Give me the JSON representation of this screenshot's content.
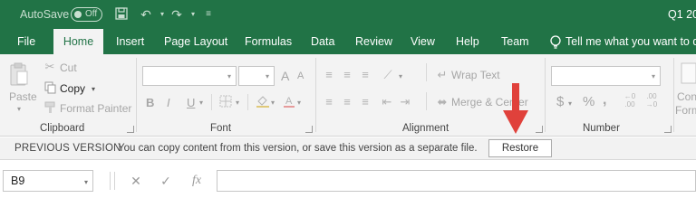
{
  "title_bar": {
    "autosave_label": "AutoSave",
    "autosave_state": "Off",
    "doc_title": "Q1 20"
  },
  "tabs": [
    "File",
    "Home",
    "Insert",
    "Page Layout",
    "Formulas",
    "Data",
    "Review",
    "View",
    "Help",
    "Team"
  ],
  "tell_me": "Tell me what you want to do",
  "clipboard": {
    "paste": "Paste",
    "cut": "Cut",
    "copy": "Copy",
    "format_painter": "Format Painter",
    "group_label": "Clipboard"
  },
  "font_group": {
    "bold": "B",
    "italic": "I",
    "underline": "U",
    "grow": "A",
    "shrink": "A",
    "group_label": "Font"
  },
  "alignment": {
    "wrap_text": "Wrap Text",
    "merge_center": "Merge & Center",
    "group_label": "Alignment"
  },
  "number": {
    "currency": "$",
    "percent": "%",
    "comma": ",",
    "group_label": "Number"
  },
  "conditional": {
    "line1": "Con",
    "line2": "Form"
  },
  "message_bar": {
    "title": "PREVIOUS VERSION",
    "message": "You can copy content from this version, or save this version as a separate file.",
    "restore_label": "Restore"
  },
  "formula_bar": {
    "name_box": "B9",
    "fx_label": "fx"
  },
  "colors": {
    "brand": "#217346",
    "arrow": "#e0413b"
  }
}
